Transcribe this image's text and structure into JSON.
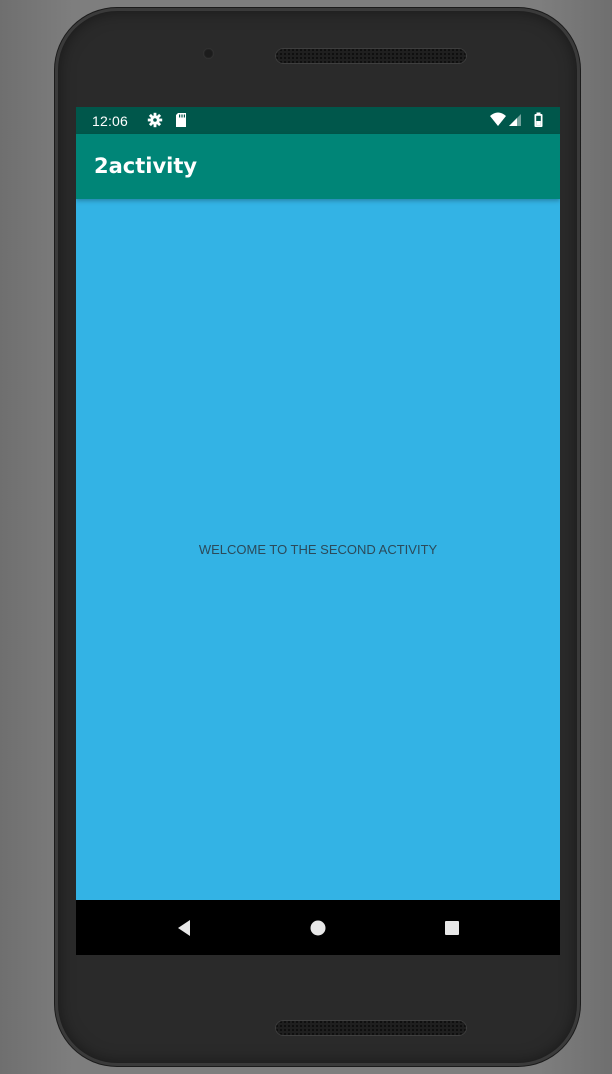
{
  "status_bar": {
    "time": "12:06",
    "left_icons": [
      "gear-icon",
      "sd-card-icon"
    ],
    "right_icons": [
      "wifi-icon",
      "signal-icon",
      "battery-icon"
    ]
  },
  "app_bar": {
    "title": "2activity"
  },
  "main": {
    "message": "WELCOME TO THE SECOND ACTIVITY"
  },
  "nav_bar": {
    "buttons": [
      "back-icon",
      "home-icon",
      "recents-icon"
    ]
  },
  "colors": {
    "status_bar": "#00574b",
    "app_bar": "#008577",
    "content_background": "#33b3e5",
    "nav_bar": "#000000"
  }
}
